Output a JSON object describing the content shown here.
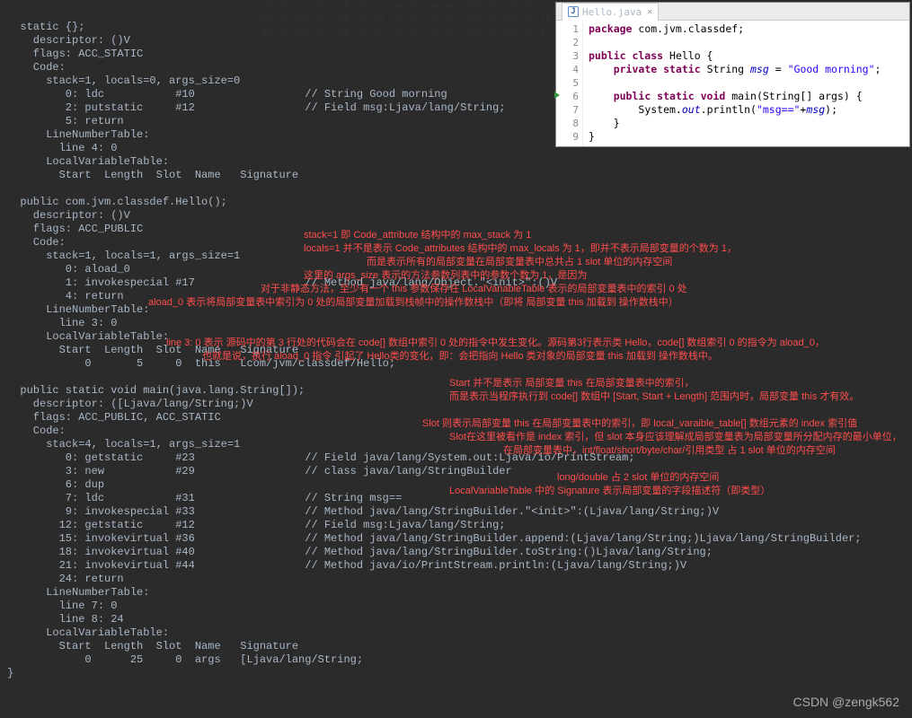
{
  "bg_noise": "                                            00 06 00 1D  5F 00 1F 00 01 00 06  00 1D 5F 00 1F  00 00 01 00 06\n                                            00 06 00 1D  5F 00 1F 00 01 00 06  00 1D 5F 00 1F  00 00 01 00 06\n                                            00 06 00 1D  5F 00 1F 00 01 00 06  00 1D 5F 00 1F  00 00 01 00 06",
  "bytecode_block1": "  static {};\n    descriptor: ()V\n    flags: ACC_STATIC\n    Code:\n      stack=1, locals=0, args_size=0\n         0: ldc           #10                 // String Good morning\n         2: putstatic     #12                 // Field msg:Ljava/lang/String;\n         5: return\n      LineNumberTable:\n        line 4: 0\n      LocalVariableTable:\n        Start  Length  Slot  Name   Signature",
  "bytecode_block2": "\n  public com.jvm.classdef.Hello();\n    descriptor: ()V\n    flags: ACC_PUBLIC\n    Code:\n      stack=1, locals=1, args_size=1\n         0: aload_0\n         1: invokespecial #17                 // Method java/lang/Object.\"<init>\":()V\n         4: return\n      LineNumberTable:\n        line 3: 0\n      LocalVariableTable:\n        Start  Length  Slot  Name   Signature\n            0       5     0  this   Lcom/jvm/classdef/Hello;",
  "bytecode_block3": "\n  public static void main(java.lang.String[]);\n    descriptor: ([Ljava/lang/String;)V\n    flags: ACC_PUBLIC, ACC_STATIC\n    Code:\n      stack=4, locals=1, args_size=1\n         0: getstatic     #23                 // Field java/lang/System.out:Ljava/io/PrintStream;\n         3: new           #29                 // class java/lang/StringBuilder\n         6: dup\n         7: ldc           #31                 // String msg==\n         9: invokespecial #33                 // Method java/lang/StringBuilder.\"<init>\":(Ljava/lang/String;)V\n        12: getstatic     #12                 // Field msg:Ljava/lang/String;\n        15: invokevirtual #36                 // Method java/lang/StringBuilder.append:(Ljava/lang/String;)Ljava/lang/StringBuilder;\n        18: invokevirtual #40                 // Method java/lang/StringBuilder.toString:()Ljava/lang/String;\n        21: invokevirtual #44                 // Method java/io/PrintStream.println:(Ljava/lang/String;)V\n        24: return\n      LineNumberTable:\n        line 7: 0\n        line 8: 24\n      LocalVariableTable:\n        Start  Length  Slot  Name   Signature\n            0      25     0  args   [Ljava/lang/String;\n}",
  "annotations": {
    "a1": "stack=1 即 Code_attribute 结构中的 max_stack 为 1",
    "a2": "locals=1 并不是表示 Code_attributes 结构中的  max_locals 为 1，即并不表示局部变量的个数为 1，",
    "a3": "而是表示所有的局部变量在局部变量表中总共占 1 slot 单位的内存空间",
    "a4": "这里的 args_size 表示的方法参数列表中的参数个数为 1，是因为",
    "a5": "对于非静态方法，至少有一个 this 参数保存在 LocalVariableTable 表示的局部变量表中的索引 0 处",
    "a6": "aload_0 表示将局部变量表中索引为 0 处的局部变量加载到栈帧中的操作数栈中（即将 局部变量 this 加载到 操作数栈中）",
    "a7": "line 3: 0 表示 源码中的第 3 行处的代码会在 code[] 数组中索引 0 处的指令中发生变化。源码第3行表示类 Hello，code[] 数组索引 0 的指令为 aload_0，",
    "a8": "也就是说，执行 aload_0 指令 引起了 Hello类的变化，即：会把指向 Hello 类对象的局部变量 this 加载到 操作数栈中。",
    "a9": "Start 并不是表示 局部变量 this 在局部变量表中的索引，",
    "a10": "而是表示当程序执行到 code[] 数组中 [Start, Start + Length] 范围内时，局部变量 this 才有效。",
    "a11": "Slot 则表示局部变量 this 在局部变量表中的索引，即 local_varaible_table[] 数组元素的 index 索引值",
    "a12": "Slot在这里被看作是 index 索引，但 slot 本身应该理解成局部变量表为局部变量所分配内存的最小单位，",
    "a13": "在局部变量表中，int/float/short/byte/char/引用类型  占 1 slot 单位的内存空间",
    "a14": "long/double  占 2 slot 单位的内存空间",
    "a15": "LocalVariableTable 中的 Signature 表示局部变量的字段描述符（即类型）"
  },
  "editor": {
    "tab_label": "Hello.java",
    "line_numbers": [
      "1",
      "2",
      "3",
      "4",
      "5",
      "6",
      "7",
      "8",
      "9"
    ],
    "src": {
      "l1_pkg": "package",
      "l1_rest": " com.jvm.classdef;",
      "l3_a": "public class",
      "l3_b": " Hello {",
      "l4_a": "private static",
      "l4_b": " String ",
      "l4_msg": "msg",
      "l4_eq": " = ",
      "l4_str": "\"Good morning\"",
      "l4_end": ";",
      "l6_a": "public static void",
      "l6_b": " main(String[] args) {",
      "l7_a": "System.",
      "l7_out": "out",
      "l7_b": ".println(",
      "l7_s": "\"msg==\"",
      "l7_p": "+",
      "l7_m": "msg",
      "l7_e": ");",
      "l8": "}",
      "l9": "}"
    }
  },
  "watermark": "CSDN @zengk562"
}
